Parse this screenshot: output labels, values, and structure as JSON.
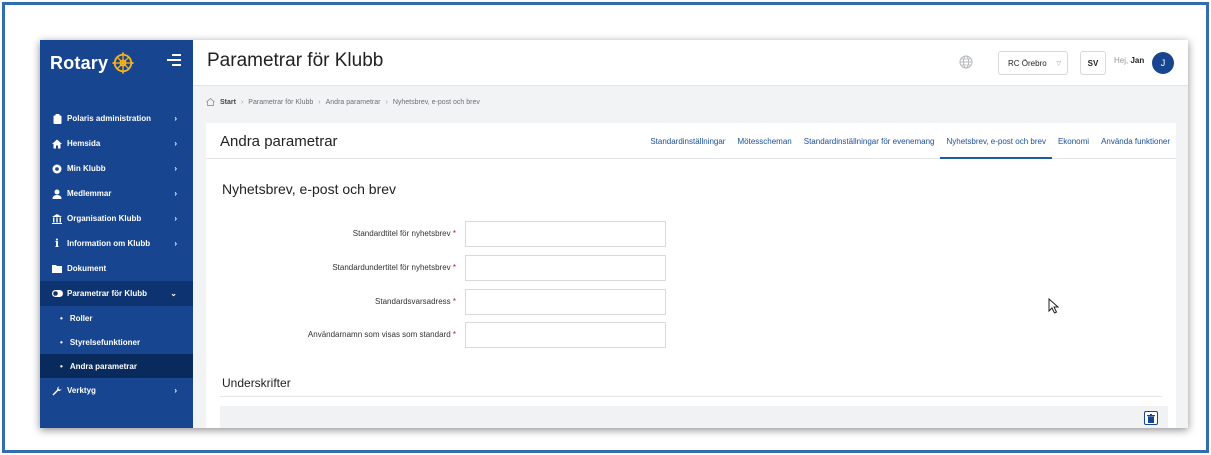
{
  "sidebar": {
    "brand": "Rotary",
    "items": [
      {
        "label": "Polaris administration",
        "icon": "clipboard-icon"
      },
      {
        "label": "Hemsida",
        "icon": "home-icon"
      },
      {
        "label": "Min Klubb",
        "icon": "rotary-icon"
      },
      {
        "label": "Medlemmar",
        "icon": "user-icon"
      },
      {
        "label": "Organisation Klubb",
        "icon": "building-icon"
      },
      {
        "label": "Information om Klubb",
        "icon": "info-icon"
      },
      {
        "label": "Dokument",
        "icon": "folder-icon"
      },
      {
        "label": "Parametrar för Klubb",
        "icon": "toggle-icon"
      },
      {
        "label": "Verktyg",
        "icon": "wrench-icon"
      }
    ],
    "subitems": [
      {
        "label": "Roller"
      },
      {
        "label": "Styrelsefunktioner"
      },
      {
        "label": "Andra parametrar"
      }
    ]
  },
  "header": {
    "title": "Parametrar för Klubb",
    "club": "RC Örebro",
    "language": "SV",
    "greeting": "Hej,",
    "user": "Jan",
    "avatar_initial": "J"
  },
  "breadcrumb": [
    "Start",
    "Parametrar för Klubb",
    "Andra parametrar",
    "Nyhetsbrev, e-post och brev"
  ],
  "card": {
    "title": "Andra parametrar",
    "tabs": [
      "Standardinställningar",
      "Mötesscheman",
      "Standardinställningar för evenemang",
      "Nyhetsbrev, e-post och brev",
      "Ekonomi",
      "Använda funktioner"
    ],
    "active_tab": "Nyhetsbrev, e-post och brev"
  },
  "form": {
    "section_title": "Nyhetsbrev, e-post och brev",
    "fields": [
      {
        "label": "Standardtitel för nyhetsbrev",
        "value": ""
      },
      {
        "label": "Standardundertitel för nyhetsbrev",
        "value": ""
      },
      {
        "label": "Standardsvarsadress",
        "value": ""
      },
      {
        "label": "Användarnamn som visas som standard",
        "value": ""
      }
    ],
    "required_mark": "*"
  },
  "signatures": {
    "title": "Underskrifter"
  },
  "colors": {
    "sidebar": "#17458f",
    "accent": "#1f5aa8",
    "required": "#c8102e"
  }
}
